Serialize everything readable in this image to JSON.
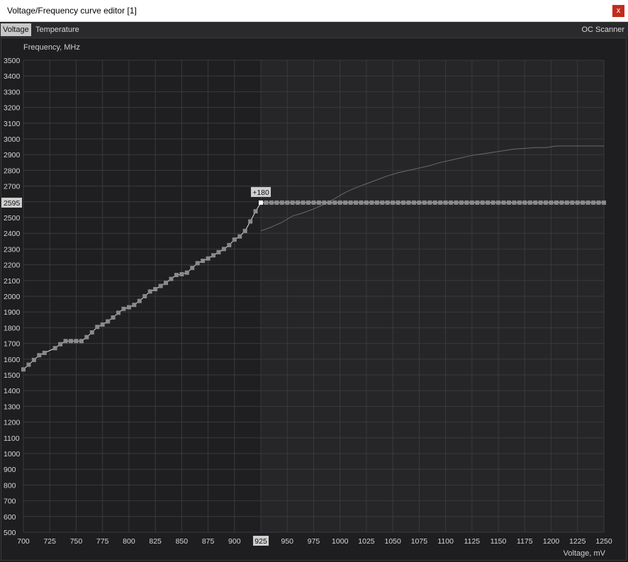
{
  "window": {
    "title": "Voltage/Frequency curve editor [1]",
    "close_glyph": "x"
  },
  "tabs": [
    {
      "label": "Voltage",
      "active": true
    },
    {
      "label": "Temperature",
      "active": false
    }
  ],
  "oc_scanner_label": "OC Scanner",
  "colors": {
    "background": "#1e1e20",
    "plot_left": "#1f1f21",
    "plot_right": "#262629",
    "grid": "#3a3a3e",
    "curve": "#e6e6e6",
    "point": "#8a8a8a",
    "reference_curve": "#6a6a6e",
    "highlight_box": "#d0d0d0"
  },
  "chart_data": {
    "type": "line",
    "ylabel": "Frequency, MHz",
    "xlabel": "Voltage, mV",
    "xlim": [
      700,
      1250
    ],
    "ylim": [
      500,
      3500
    ],
    "x_ticks": [
      700,
      725,
      750,
      775,
      800,
      825,
      850,
      875,
      900,
      925,
      950,
      975,
      1000,
      1025,
      1050,
      1075,
      1100,
      1125,
      1150,
      1175,
      1200,
      1225,
      1250
    ],
    "y_ticks": [
      500,
      600,
      700,
      800,
      900,
      1000,
      1100,
      1200,
      1300,
      1400,
      1500,
      1600,
      1700,
      1800,
      1900,
      2000,
      2100,
      2200,
      2300,
      2400,
      2500,
      2600,
      2700,
      2800,
      2900,
      3000,
      3100,
      3200,
      3300,
      3400,
      3500
    ],
    "grid": true,
    "selected_voltage": 925,
    "selected_frequency": 2595,
    "selected_voltage_label": "925",
    "selected_frequency_label": "2595",
    "offset_label": "+180",
    "series": [
      {
        "role": "edited-curve",
        "x": [
          700,
          705,
          710,
          715,
          720,
          730,
          735,
          740,
          745,
          750,
          755,
          760,
          765,
          770,
          775,
          780,
          785,
          790,
          795,
          800,
          805,
          810,
          815,
          820,
          825,
          830,
          835,
          840,
          845,
          850,
          855,
          860,
          865,
          870,
          875,
          880,
          885,
          890,
          895,
          900,
          905,
          910,
          915,
          920,
          925,
          930,
          935,
          940,
          945,
          950,
          955,
          960,
          965,
          970,
          975,
          980,
          985,
          990,
          995,
          1000,
          1005,
          1010,
          1015,
          1020,
          1025,
          1030,
          1035,
          1040,
          1045,
          1050,
          1055,
          1060,
          1065,
          1070,
          1075,
          1080,
          1085,
          1090,
          1095,
          1100,
          1105,
          1110,
          1115,
          1120,
          1125,
          1130,
          1135,
          1140,
          1145,
          1150,
          1155,
          1160,
          1165,
          1170,
          1175,
          1180,
          1185,
          1190,
          1195,
          1200,
          1205,
          1210,
          1215,
          1220,
          1225,
          1230,
          1235,
          1240,
          1245,
          1250
        ],
        "y": [
          1535,
          1565,
          1595,
          1625,
          1640,
          1670,
          1695,
          1715,
          1715,
          1715,
          1715,
          1740,
          1770,
          1805,
          1820,
          1840,
          1865,
          1895,
          1920,
          1930,
          1945,
          1970,
          2000,
          2030,
          2045,
          2065,
          2085,
          2110,
          2135,
          2140,
          2150,
          2180,
          2210,
          2225,
          2240,
          2260,
          2280,
          2300,
          2325,
          2360,
          2380,
          2415,
          2475,
          2540,
          2595,
          2595,
          2595,
          2595,
          2595,
          2595,
          2595,
          2595,
          2595,
          2595,
          2595,
          2595,
          2595,
          2595,
          2595,
          2595,
          2595,
          2595,
          2595,
          2595,
          2595,
          2595,
          2595,
          2595,
          2595,
          2595,
          2595,
          2595,
          2595,
          2595,
          2595,
          2595,
          2595,
          2595,
          2595,
          2595,
          2595,
          2595,
          2595,
          2595,
          2595,
          2595,
          2595,
          2595,
          2595,
          2595,
          2595,
          2595,
          2595,
          2595,
          2595,
          2595,
          2595,
          2595,
          2595,
          2595,
          2595,
          2595,
          2595,
          2595,
          2595,
          2595,
          2595,
          2595,
          2595,
          2595
        ]
      },
      {
        "role": "default-curve",
        "x": [
          925,
          935,
          945,
          955,
          965,
          975,
          985,
          995,
          1005,
          1015,
          1025,
          1035,
          1045,
          1055,
          1065,
          1075,
          1085,
          1095,
          1105,
          1115,
          1125,
          1135,
          1145,
          1155,
          1165,
          1175,
          1185,
          1195,
          1205,
          1215,
          1225,
          1235,
          1250
        ],
        "y": [
          2415,
          2440,
          2470,
          2510,
          2530,
          2555,
          2585,
          2620,
          2660,
          2690,
          2715,
          2740,
          2765,
          2785,
          2800,
          2815,
          2830,
          2850,
          2865,
          2880,
          2895,
          2905,
          2915,
          2925,
          2935,
          2940,
          2945,
          2945,
          2955,
          2955,
          2955,
          2955,
          2955
        ]
      }
    ]
  }
}
